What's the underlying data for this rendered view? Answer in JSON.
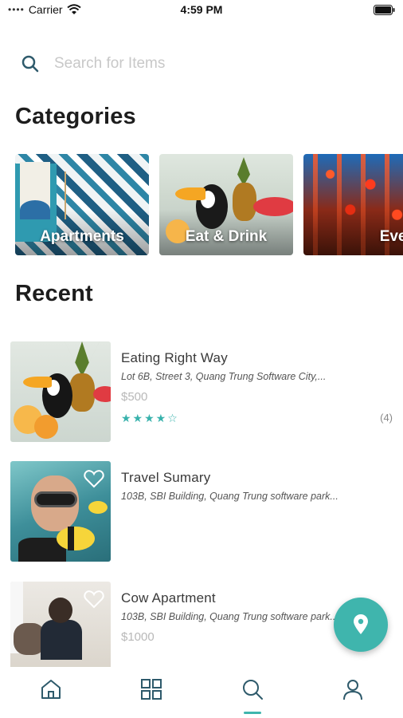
{
  "status_bar": {
    "carrier": "Carrier",
    "time": "4:59 PM"
  },
  "search": {
    "placeholder": "Search for Items"
  },
  "sections": {
    "categories_title": "Categories",
    "recent_title": "Recent"
  },
  "categories": [
    {
      "label": "Apartments"
    },
    {
      "label": "Eat & Drink"
    },
    {
      "label": "Events"
    }
  ],
  "recent": [
    {
      "title": "Eating Right Way",
      "address": "Lot 6B, Street 3, Quang Trung Software City,...",
      "price": "$500",
      "stars": "★★★★☆",
      "rating": 4,
      "count": "(4)"
    },
    {
      "title": "Travel Sumary",
      "address": "103B, SBI Building, Quang Trung software park..."
    },
    {
      "title": "Cow Apartment",
      "address": "103B, SBI Building, Quang Trung software park...",
      "price": "$1000"
    }
  ],
  "icons": {
    "search": "search-icon",
    "heart": "heart-outline-icon",
    "fab": "map-pin-icon",
    "tabs": [
      "home-icon",
      "grid-icon",
      "search-icon",
      "user-icon"
    ]
  },
  "colors": {
    "accent": "#3fb5ad",
    "star": "#38b2ac",
    "tab_icon": "#2e5a6b"
  },
  "tab_bar": {
    "active_index": 2
  }
}
